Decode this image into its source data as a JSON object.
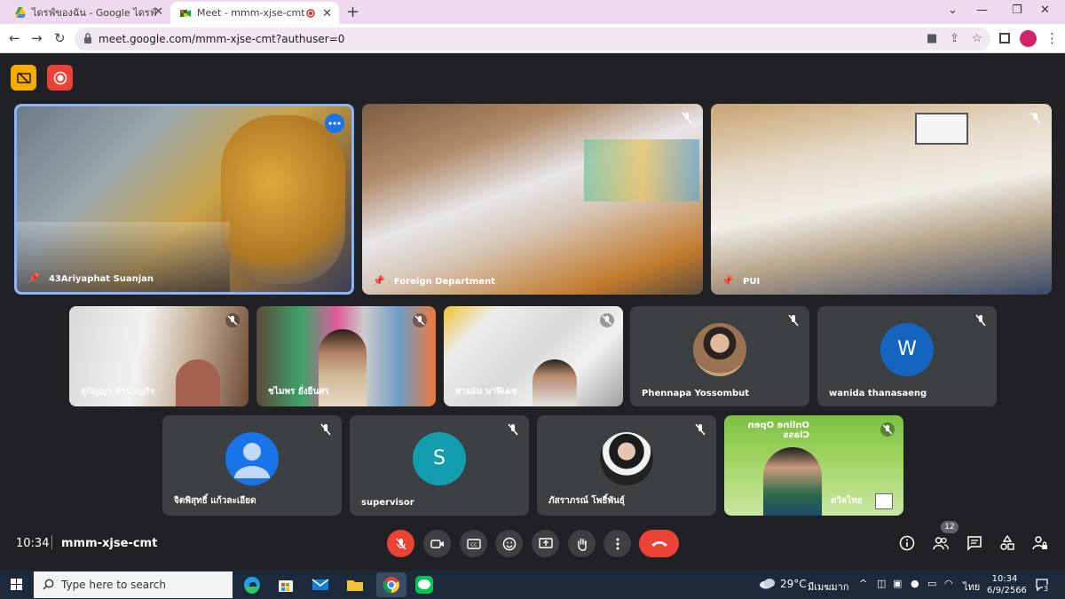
{
  "browser": {
    "tabs": [
      {
        "title": "ไดรฟ์ของฉัน - Google ไดรฟ์",
        "icon": "google-drive-icon"
      },
      {
        "title": "Meet - mmm-xjse-cmt",
        "icon": "google-meet-icon",
        "active": true
      }
    ],
    "url": "meet.google.com/mmm-xjse-cmt?authuser=0"
  },
  "meet": {
    "tiles_row1": [
      {
        "name": "43Ariyaphat Suanjan",
        "pinned": true,
        "active_speaker": true
      },
      {
        "name": "Foreign Department",
        "pinned": true
      },
      {
        "name": "PUI",
        "pinned": true
      }
    ],
    "tiles_row2": [
      {
        "name": "สุกัญญา ชำนาญกิจ"
      },
      {
        "name": "ชไมพร ยั่งยืนศร"
      },
      {
        "name": "สายฝน นาฬิเดช"
      },
      {
        "name": "Phennapa Yossombut",
        "avatar": "photo"
      },
      {
        "name": "wanida thanasaeng",
        "avatar_letter": "W",
        "avatar_color": "#1565c0"
      }
    ],
    "tiles_row3": [
      {
        "name": "จิตพิสุทธิ์ แก้วละเอียด",
        "avatar": "default-person"
      },
      {
        "name": "supervisor",
        "avatar_letter": "S",
        "avatar_color": "#129eaf"
      },
      {
        "name": "ภัสราภรณ์ โพธิ์พันธุ์",
        "avatar": "photo"
      },
      {
        "name": "ดวิลไทย",
        "screen_text": "Online Open Class"
      }
    ],
    "clock": "10:34",
    "meeting_code": "mmm-xjse-cmt",
    "participant_count": "12"
  },
  "taskbar": {
    "search_placeholder": "Type here to search",
    "weather_temp": "29°C",
    "weather_desc": "มีเมฆมาก",
    "lang": "ไทย",
    "time": "10:34",
    "date": "6/9/2566",
    "notif_count": "3"
  },
  "colors": {
    "meet_bg": "#202124",
    "tile_grey": "#3c4043",
    "end_call": "#ea4335",
    "speaker_border": "#8ab4f8"
  }
}
